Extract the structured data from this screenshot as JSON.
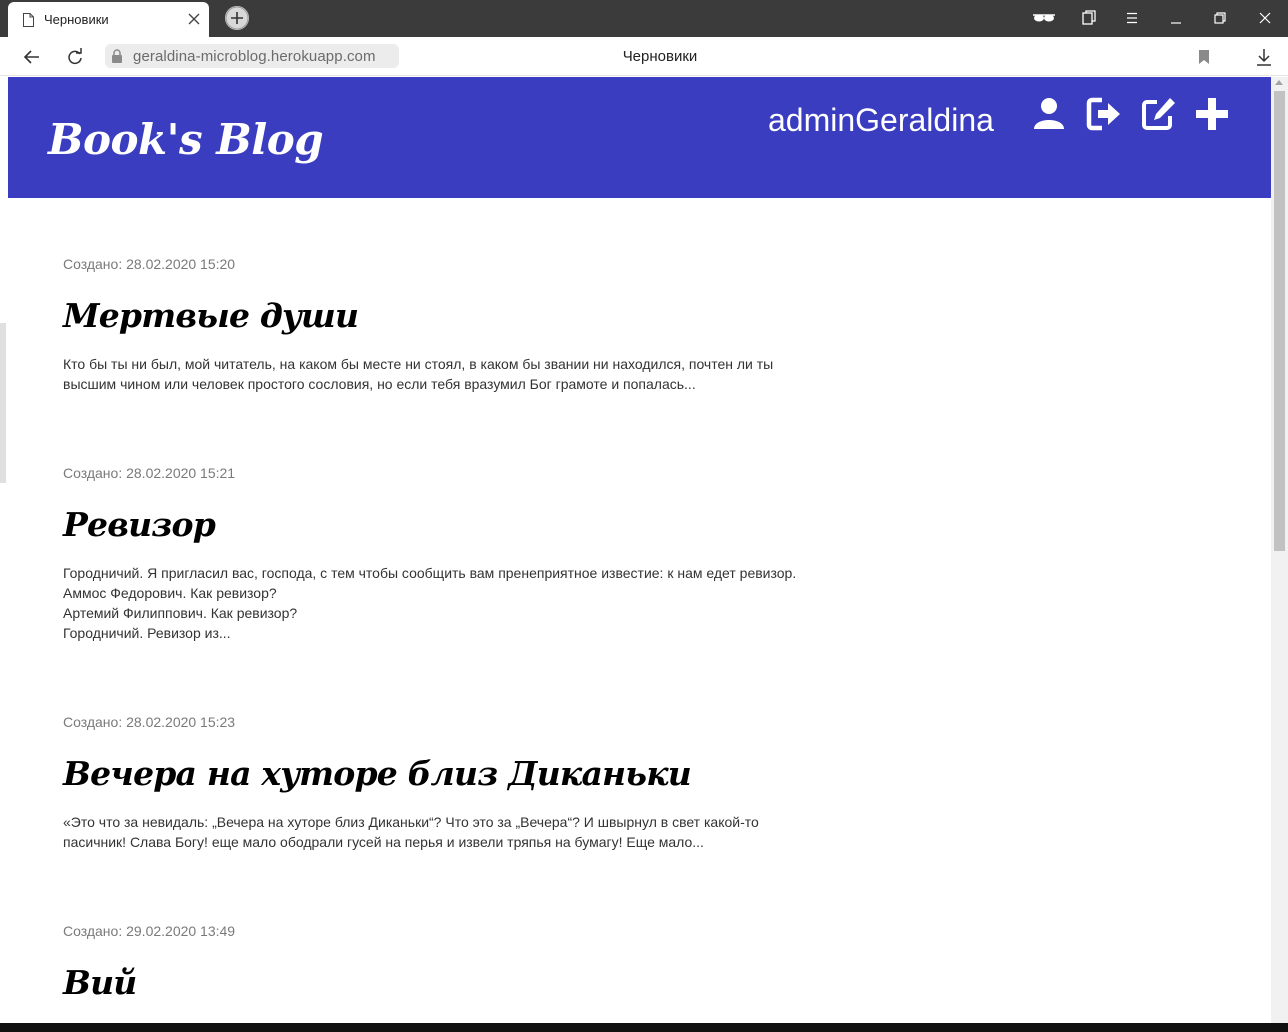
{
  "browser": {
    "tab_title": "Черновики",
    "url": "geraldina-microblog.herokuapp.com",
    "page_title": "Черновики"
  },
  "header": {
    "brand": "Book's Blog",
    "username": "adminGeraldina"
  },
  "posts": [
    {
      "date": "Создано: 28.02.2020 15:20",
      "title": "Мертвые души",
      "lines": [
        "Кто бы ты ни был, мой читатель, на каком бы месте ни стоял, в каком бы звании ни находился, почтен ли ты",
        "высшим чином или человек простого сословия, но если тебя вразумил Бог грамоте и попалась..."
      ]
    },
    {
      "date": "Создано: 28.02.2020 15:21",
      "title": "Ревизор",
      "lines": [
        "Городничий. Я пригласил вас, господа, с тем чтобы сообщить вам пренеприятное известие: к нам едет ревизор.",
        "Аммос Федорович. Как ревизор?",
        "Артемий Филиппович. Как ревизор?",
        "Городничий. Ревизор из..."
      ]
    },
    {
      "date": "Создано: 28.02.2020 15:23",
      "title": "Вечера на хуторе близ Диканьки",
      "lines": [
        "«Это что за невидаль: „Вечера на хуторе близ Диканьки“? Что это за „Вечера“? И швырнул в свет какой-то",
        "пасичник! Слава Богу! еще мало ободрали гусей на перья и извели тряпья на бумагу! Еще мало..."
      ]
    },
    {
      "date": "Создано: 29.02.2020 13:49",
      "title": "Вий",
      "lines": []
    }
  ],
  "icons": {
    "page": "page-icon",
    "close_tab": "close-icon",
    "new_tab": "plus-icon",
    "reader": "glasses-icon",
    "tabs": "tabs-icon",
    "menu": "hamburger-icon",
    "minimize": "minimize-icon",
    "restore": "restore-icon",
    "close": "close-icon",
    "back": "arrow-left-icon",
    "reload": "reload-icon",
    "lock": "lock-icon",
    "bookmark": "bookmark-icon",
    "download": "download-icon",
    "profile": "user-icon",
    "logout": "logout-icon",
    "edit": "edit-icon",
    "add_post": "plus-icon"
  },
  "colors": {
    "header_bg": "#3a3dc0",
    "titlebar_bg": "#3b3b3b",
    "date_text": "#7a7a7a",
    "body_text": "#333333"
  }
}
